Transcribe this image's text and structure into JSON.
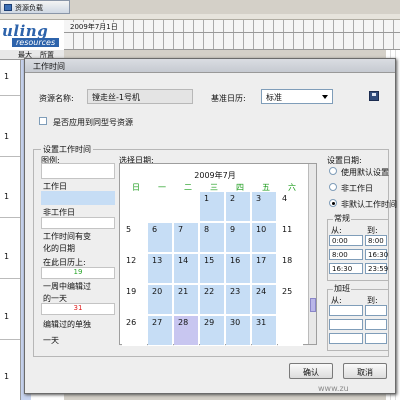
{
  "app": {
    "tab_label": "资源负载",
    "logo_main": "uling",
    "logo_sub": "resources",
    "timeline_date": "2009年7月1日",
    "col_a": "最大",
    "col_b": "所置",
    "row_labels": [
      "1",
      "1",
      "1",
      "1",
      "1",
      "1"
    ]
  },
  "dialog": {
    "title": "工作时间",
    "resource_label": "资源名称:",
    "resource_value": "镗走丝-1号机",
    "calendar_label": "基准日历:",
    "calendar_value": "标准",
    "apply_same_type": "是否应用到同型号资源",
    "group_title": "设置工作时间",
    "legend_title": "图例:",
    "select_date_label": "选择日期:",
    "legend": {
      "workday": "工作日",
      "nonworkday": "非工作日",
      "changed_line1": "工作时间有变",
      "changed_line2": "化的日期",
      "on_calendar": "在此日历上:",
      "marker_19": "19",
      "weekly_line1": "一周中编辑过",
      "weekly_line2": "的一天",
      "marker_31": "31",
      "single_line1": "编辑过的单独",
      "single_line2": "一天"
    },
    "calendar": {
      "title": "2009年7月",
      "weekdays": [
        "日",
        "一",
        "二",
        "三",
        "四",
        "五",
        "六"
      ],
      "weeks": [
        [
          "",
          "",
          "",
          "1",
          "2",
          "3",
          "4"
        ],
        [
          "5",
          "6",
          "7",
          "8",
          "9",
          "10",
          "11"
        ],
        [
          "12",
          "13",
          "14",
          "15",
          "16",
          "17",
          "18"
        ],
        [
          "19",
          "20",
          "21",
          "22",
          "23",
          "24",
          "25"
        ],
        [
          "26",
          "27",
          "28",
          "29",
          "30",
          "31",
          ""
        ]
      ]
    },
    "set_date_label": "设置日期:",
    "radio_default": "使用默认设置",
    "radio_nonwork": "非工作日",
    "radio_custom": "非默认工作时间",
    "regular_label": "常规",
    "from_label": "从:",
    "to_label": "到:",
    "regular_times": [
      [
        "0:00",
        "8:00"
      ],
      [
        "8:00",
        "16:30"
      ],
      [
        "16:30",
        "23:59"
      ]
    ],
    "overtime_label": "加班",
    "ok_label": "确认",
    "cancel_label": "取消"
  },
  "watermark": "www.zu"
}
